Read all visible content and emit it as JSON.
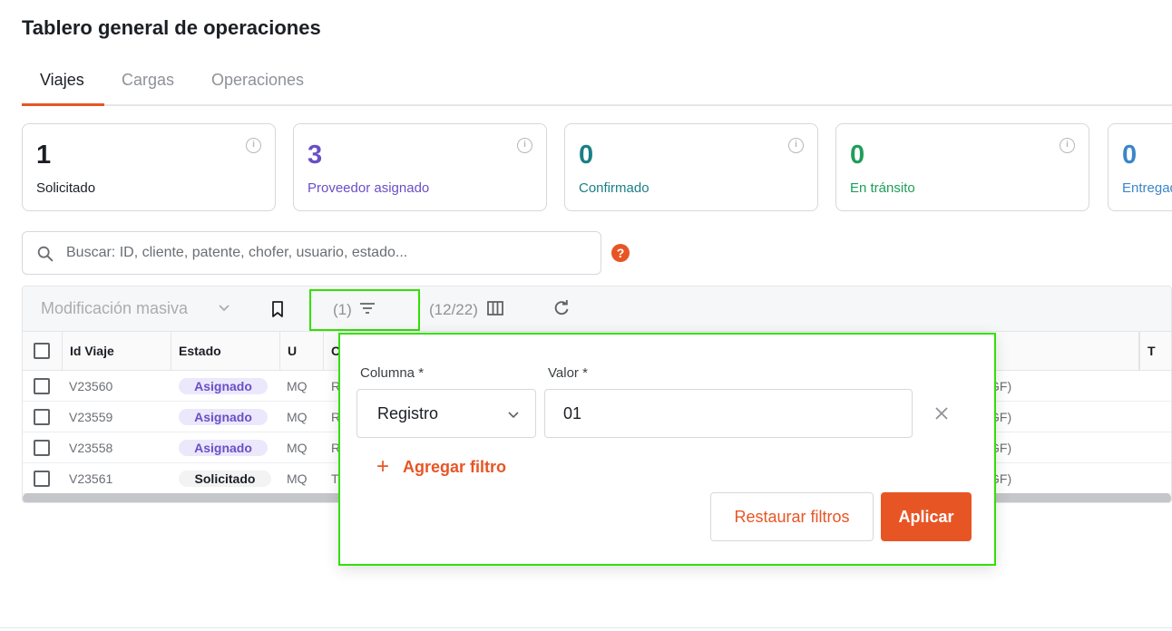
{
  "page": {
    "title": "Tablero general de operaciones"
  },
  "tabs": [
    {
      "label": "Viajes",
      "active": true
    },
    {
      "label": "Cargas",
      "active": false
    },
    {
      "label": "Operaciones",
      "active": false
    }
  ],
  "kpis": [
    {
      "value": "1",
      "label": "Solicitado",
      "color": "#1b1f24",
      "label_color": "#1b1f24"
    },
    {
      "value": "3",
      "label": "Proveedor asignado",
      "color": "#6a4fc7",
      "label_color": "#6a4fc7"
    },
    {
      "value": "0",
      "label": "Confirmado",
      "color": "#1a7f86",
      "label_color": "#1a7f86"
    },
    {
      "value": "0",
      "label": "En tránsito",
      "color": "#1e9e5a",
      "label_color": "#1e9e5a"
    },
    {
      "value": "0",
      "label": "Entregado",
      "color": "#3a86c8",
      "label_color": "#3a86c8"
    }
  ],
  "search": {
    "placeholder": "Buscar: ID, cliente, patente, chofer, usuario, estado...",
    "help": "?"
  },
  "toolbar": {
    "mass_edit": "Modificación masiva",
    "filter_count": "(1)",
    "columns_count": "(12/22)"
  },
  "table": {
    "columns": [
      "Id Viaje",
      "Estado",
      "U",
      "C",
      "T"
    ],
    "rows": [
      {
        "id": "V23560",
        "status": "Asignado",
        "status_kind": "assigned",
        "u": "MQ",
        "c": "R",
        "tail": "GF)"
      },
      {
        "id": "V23559",
        "status": "Asignado",
        "status_kind": "assigned",
        "u": "MQ",
        "c": "R",
        "tail": "GF)"
      },
      {
        "id": "V23558",
        "status": "Asignado",
        "status_kind": "assigned",
        "u": "MQ",
        "c": "R",
        "tail": "GF)"
      },
      {
        "id": "V23561",
        "status": "Solicitado",
        "status_kind": "requested",
        "u": "MQ",
        "c": "T",
        "tail": "GF)"
      }
    ]
  },
  "filter_popover": {
    "column_label": "Columna *",
    "value_label": "Valor *",
    "column_value": "Registro",
    "value_value": "01",
    "add_filter": "Agregar filtro",
    "add_symbol": "+",
    "reset": "Restaurar filtros",
    "apply": "Aplicar"
  },
  "colors": {
    "accent": "#e85525",
    "highlight": "#33e000"
  }
}
